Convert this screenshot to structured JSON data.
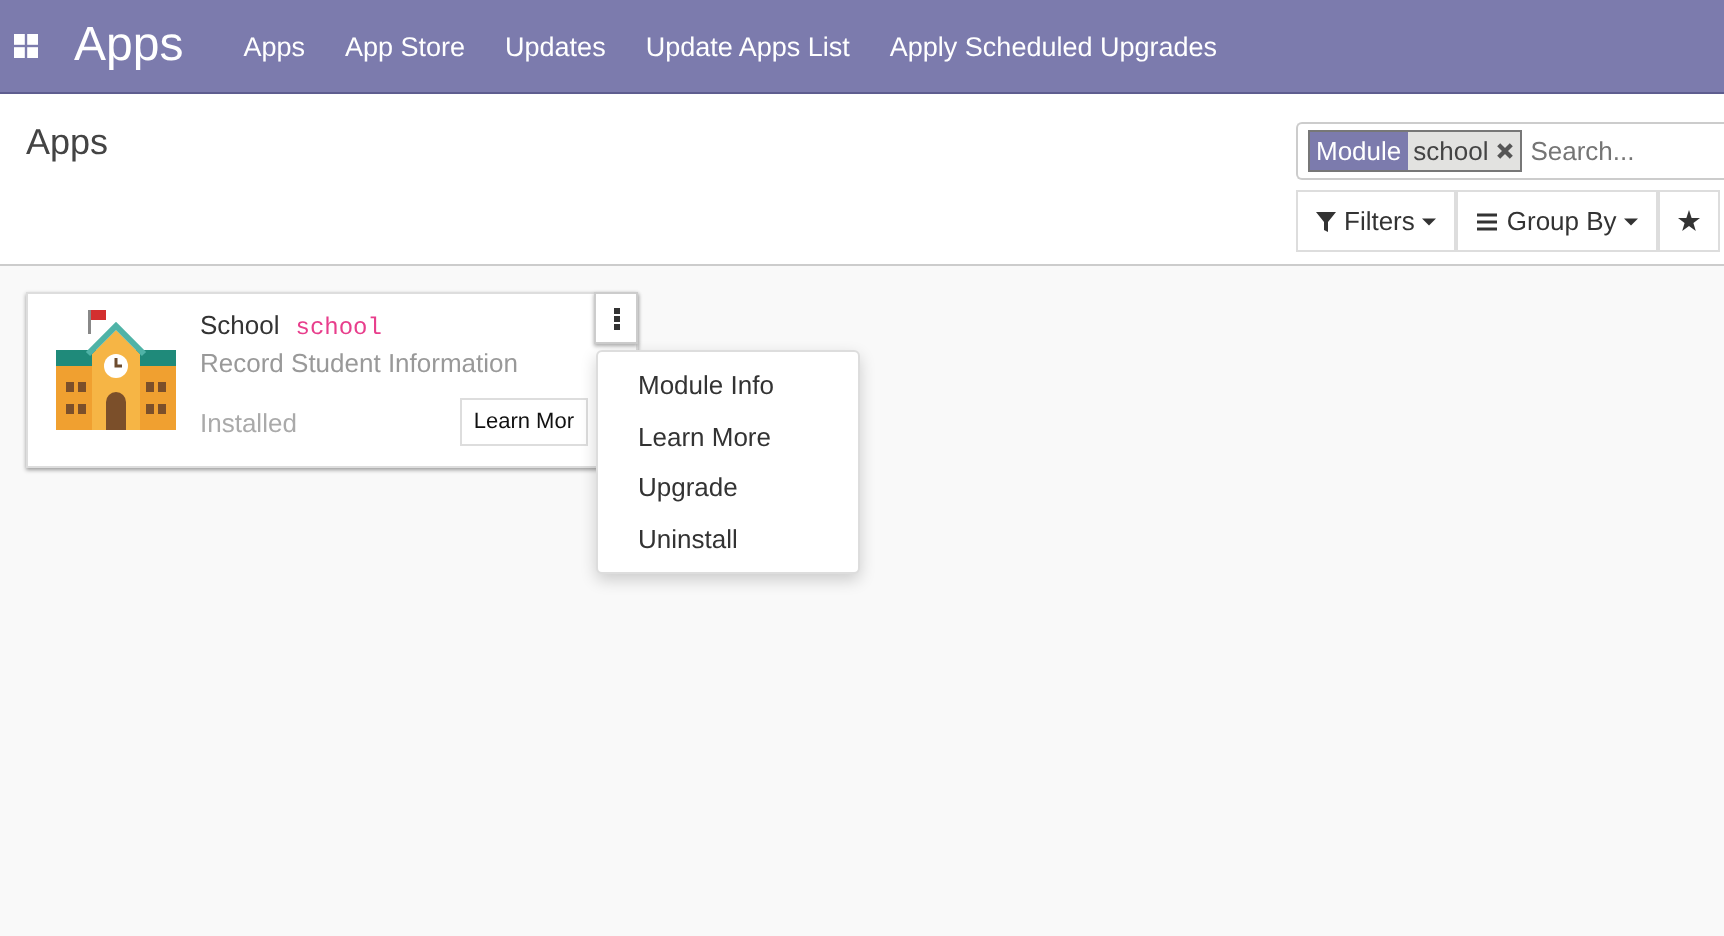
{
  "navbar": {
    "app_title": "Apps",
    "menu": [
      "Apps",
      "App Store",
      "Updates",
      "Update Apps List",
      "Apply Scheduled Upgrades"
    ]
  },
  "control_panel": {
    "breadcrumb": "Apps",
    "search": {
      "facet_label": "Module",
      "facet_value": "school",
      "placeholder": "Search..."
    },
    "buttons": [
      {
        "kind": "filter",
        "label": "Filters"
      },
      {
        "kind": "group",
        "label": "Group By"
      },
      {
        "kind": "favorites"
      }
    ]
  },
  "apps": [
    {
      "name": "School",
      "technical_name": "school",
      "summary": "Record Student Information",
      "status": "Installed",
      "button": "Learn Mor",
      "menu_open": true,
      "menu": [
        "Module Info",
        "Learn More",
        "Upgrade",
        "Uninstall"
      ]
    }
  ]
}
